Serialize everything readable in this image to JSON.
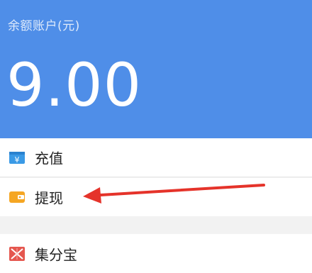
{
  "balance": {
    "label": "余额账户(元)",
    "amount": "9.00"
  },
  "menu": {
    "recharge": {
      "label": "充值",
      "icon": "wallet-yuan-icon"
    },
    "withdraw": {
      "label": "提现",
      "icon": "wallet-icon"
    },
    "jifenbao": {
      "label": "集分宝",
      "icon": "jifenbao-icon"
    }
  },
  "colors": {
    "header_bg": "#4f8ee8",
    "recharge_icon": "#3a9ae6",
    "withdraw_icon": "#f5a623",
    "jifenbao_icon": "#e5574f",
    "annotation_arrow": "#e5332a"
  }
}
